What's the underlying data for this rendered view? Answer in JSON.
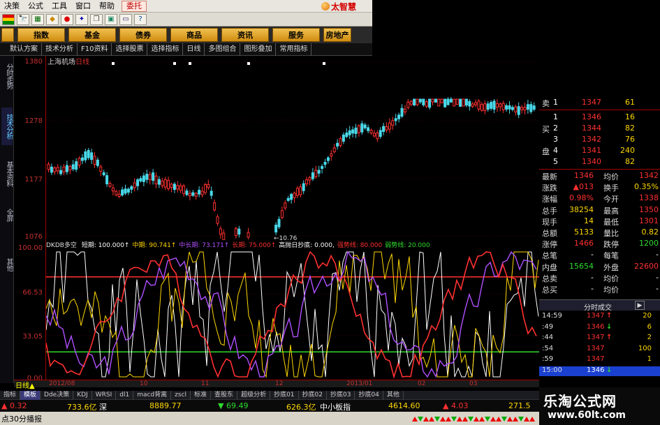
{
  "menu": {
    "items": [
      "决策",
      "公式",
      "工具",
      "窗口",
      "帮助"
    ],
    "delegate": "委托",
    "brand": "太智慧"
  },
  "icons": [
    "flag-icon",
    "binoculars-icon",
    "grid-icon",
    "diamond-icon",
    "bubble-icon",
    "star-icon",
    "copy-icon",
    "image-icon",
    "window-icon",
    "help-icon"
  ],
  "categories": [
    "指数",
    "基金",
    "债券",
    "商品",
    "资讯",
    "服务",
    "房地产"
  ],
  "tabs": [
    "默认方案",
    "技术分析",
    "F10资料",
    "选择股票",
    "选择指标",
    "日线",
    "多图组合",
    "图形叠加",
    "常用指标"
  ],
  "vtabs": [
    "分时走势",
    "技术分析",
    "基本资料",
    "全屏",
    "其他"
  ],
  "stock": {
    "name": "上海机场",
    "period": "日线"
  },
  "main_axis": {
    "labels": [
      "1380",
      "1278",
      "1177",
      "1076"
    ],
    "low_marker": "10.76"
  },
  "indicator": {
    "name": "DKDB多空",
    "params": [
      {
        "label": "短期:",
        "value": "100.000↑",
        "color": "#ffffff"
      },
      {
        "label": "中期:",
        "value": "90.741↑",
        "color": "#ffd700"
      },
      {
        "label": "中长期:",
        "value": "73.171↑",
        "color": "#b050ff"
      },
      {
        "label": "长期:",
        "value": "75.000↑",
        "color": "#ff3030"
      },
      {
        "label": "高抛日抄底:",
        "value": "0.000,",
        "color": "#ffffff"
      },
      {
        "label": "强势线:",
        "value": "80.000",
        "color": "#ff3030"
      },
      {
        "label": "弱势线:",
        "value": "20.000",
        "color": "#2fdc2f"
      }
    ],
    "axis": [
      "100.00",
      "66.53",
      "33.05",
      "0.00"
    ],
    "strong_line": 80,
    "weak_line": 20
  },
  "date_axis": {
    "period": "日线",
    "labels": [
      "2012/08",
      "10",
      "11",
      "12",
      "2013/01",
      "02",
      "03"
    ]
  },
  "indicator_tabs": [
    "指标",
    "模板",
    "Dde决策",
    "KDJ",
    "WRSI",
    "dl1",
    "macd背离",
    "zscl",
    "标准",
    "查股东",
    "超级分析",
    "抄底01",
    "抄底02",
    "抄底03",
    "抄底04",
    "其他"
  ],
  "index_bar": {
    "v1": "▲ 0.32",
    "v2": "733.6亿",
    "v3": "深",
    "v4": "8889.77",
    "v5": "▼ 69.49",
    "v6": "626.3亿",
    "v7": "中小板指",
    "v8": "4614.60",
    "v9": "▲ 4.03",
    "v10": "271.5"
  },
  "status": {
    "text": "点30分播报"
  },
  "quote": {
    "sell": [
      {
        "label": "卖",
        "level": "1",
        "price": "1347",
        "vol": "61"
      }
    ],
    "buy_label_1": "买",
    "buy_label_2": "盘",
    "buy": [
      {
        "level": "1",
        "price": "1346",
        "vol": "16"
      },
      {
        "level": "2",
        "price": "1344",
        "vol": "82"
      },
      {
        "level": "3",
        "price": "1342",
        "vol": "76"
      },
      {
        "level": "4",
        "price": "1341",
        "vol": "240"
      },
      {
        "level": "5",
        "price": "1340",
        "vol": "82"
      }
    ],
    "stats": [
      {
        "l1": "最新",
        "v1": "1346",
        "l2": "均价",
        "v2": "1342",
        "c1": "up",
        "c2": "up"
      },
      {
        "l1": "涨跌",
        "v1": "▲013",
        "l2": "换手",
        "v2": "0.35%",
        "c1": "up",
        "c2": "vol"
      },
      {
        "l1": "涨幅",
        "v1": "0.98%",
        "l2": "今开",
        "v2": "1338",
        "c1": "up",
        "c2": "up"
      },
      {
        "l1": "总手",
        "v1": "38254",
        "l2": "最高",
        "v2": "1350",
        "c1": "vol",
        "c2": "up"
      },
      {
        "l1": "现手",
        "v1": "14",
        "l2": "最低",
        "v2": "1301",
        "c1": "vol",
        "c2": "up"
      },
      {
        "l1": "总额",
        "v1": "5133",
        "l2": "量比",
        "v2": "0.82",
        "c1": "vol",
        "c2": "vol"
      },
      {
        "l1": "涨停",
        "v1": "1466",
        "l2": "跌停",
        "v2": "1200",
        "c1": "up",
        "c2": "dn"
      },
      {
        "l1": "总笔",
        "v1": "-",
        "l2": "每笔",
        "v2": "-",
        "c1": "wh",
        "c2": "wh"
      },
      {
        "l1": "内盘",
        "v1": "15654",
        "l2": "外盘",
        "v2": "22600",
        "c1": "dn",
        "c2": "up"
      },
      {
        "l1": "总卖",
        "v1": "-",
        "l2": "均价",
        "v2": "-",
        "c1": "wh",
        "c2": "wh"
      },
      {
        "l1": "总买",
        "v1": "-",
        "l2": "均价",
        "v2": "-",
        "c1": "wh",
        "c2": "wh"
      }
    ]
  },
  "ticks": {
    "title": "分时成交",
    "btn": "▶",
    "rows": [
      {
        "time": "14:59",
        "price": "1347",
        "arrow": "↑",
        "vol": "20",
        "dir": "up"
      },
      {
        "time": ":49",
        "price": "1346",
        "arrow": "↓",
        "vol": "6",
        "dir": "dn"
      },
      {
        "time": ":44",
        "price": "1347",
        "arrow": "↑",
        "vol": "2",
        "dir": "up"
      },
      {
        "time": ":54",
        "price": "1347",
        "arrow": "",
        "vol": "100",
        "dir": "up"
      },
      {
        "time": ":59",
        "price": "1347",
        "arrow": "",
        "vol": "1",
        "dir": "up"
      },
      {
        "time": "15:00",
        "price": "1346",
        "arrow": "↓",
        "vol": "",
        "dir": "dn"
      }
    ]
  },
  "watermark": {
    "line1": "乐淘公式网",
    "line2": "www.60lt.com"
  },
  "colors": {
    "up": "#ff3030",
    "down": "#2fdc2f",
    "cyan_candle": "#48d8e8",
    "yellow": "#ffd700"
  }
}
